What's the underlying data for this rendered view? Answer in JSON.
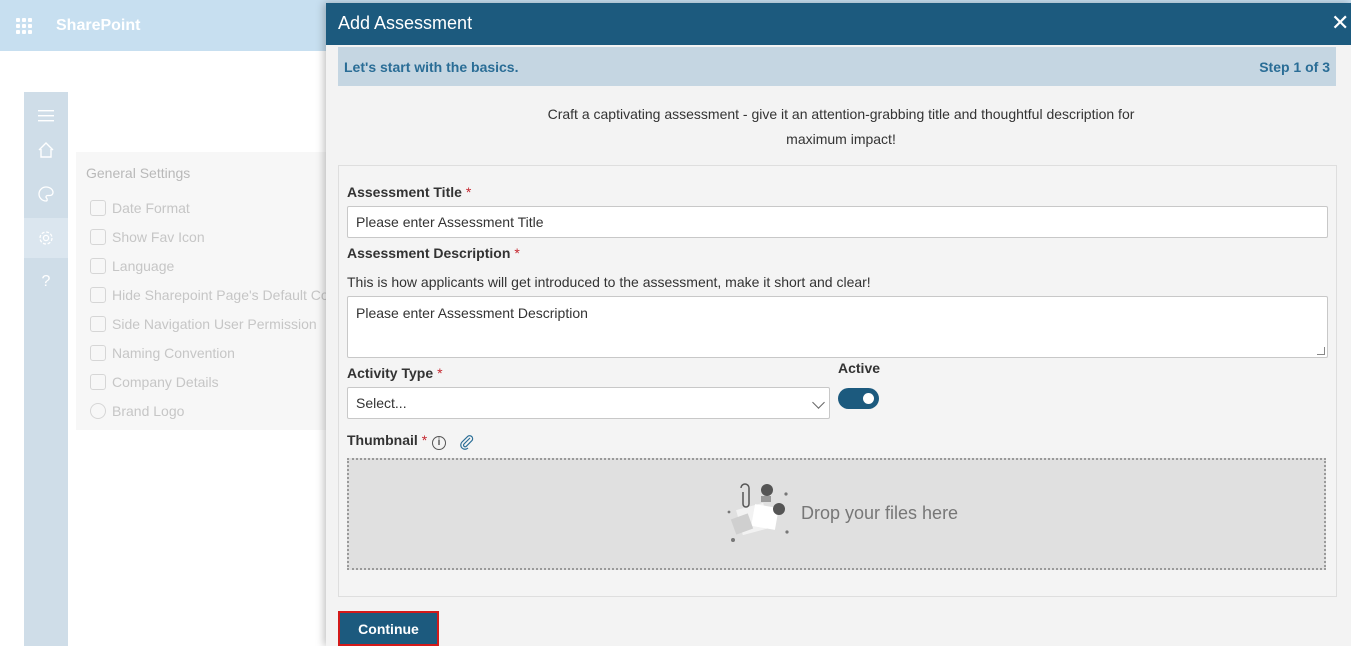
{
  "app": {
    "brand": "SharePoint"
  },
  "rail": {
    "items": [
      {
        "name": "menu-icon"
      },
      {
        "name": "home-icon"
      },
      {
        "name": "palette-icon"
      },
      {
        "name": "gear-icon",
        "selected": true
      },
      {
        "name": "help-icon",
        "glyph": "?"
      }
    ]
  },
  "settings_panel": {
    "title": "General Settings",
    "items": [
      {
        "label": "Date Format",
        "icon": "calendar-icon"
      },
      {
        "label": "Show Fav Icon",
        "icon": "fav-icon"
      },
      {
        "label": "Language",
        "icon": "language-icon"
      },
      {
        "label": "Hide Sharepoint Page's Default Co",
        "icon": "page-icon"
      },
      {
        "label": "Side Navigation User Permission",
        "icon": "users-icon"
      },
      {
        "label": "Naming Convention",
        "icon": "naming-icon"
      },
      {
        "label": "Company Details",
        "icon": "org-icon"
      },
      {
        "label": "Brand Logo",
        "icon": "badge-icon"
      }
    ]
  },
  "modal": {
    "title": "Add Assessment",
    "close_glyph": "✕",
    "step": {
      "text": "Let's start with the basics.",
      "count": "Step 1 of 3"
    },
    "intro": "Craft a captivating assessment - give it an attention-grabbing title and thoughtful description for maximum impact!",
    "fields": {
      "title": {
        "label": "Assessment Title",
        "required": "*",
        "placeholder": "Please enter Assessment Title"
      },
      "description": {
        "label": "Assessment Description",
        "required": "*",
        "helper": "This is how applicants will get introduced to the assessment, make it short and clear!",
        "placeholder": "Please enter Assessment Description"
      },
      "activity_type": {
        "label": "Activity Type",
        "required": "*",
        "value": "Select..."
      },
      "active": {
        "label": "Active",
        "on": true
      },
      "thumbnail": {
        "label": "Thumbnail",
        "required": "*",
        "info_glyph": "i",
        "drop_text": "Drop your files here"
      }
    },
    "continue_label": "Continue"
  },
  "colors": {
    "header": "#1c5a7e",
    "step_bar": "#c5d6e2",
    "accent_text": "#2a6d96",
    "required": "#c4262e",
    "highlight_border": "#d31a1a"
  }
}
